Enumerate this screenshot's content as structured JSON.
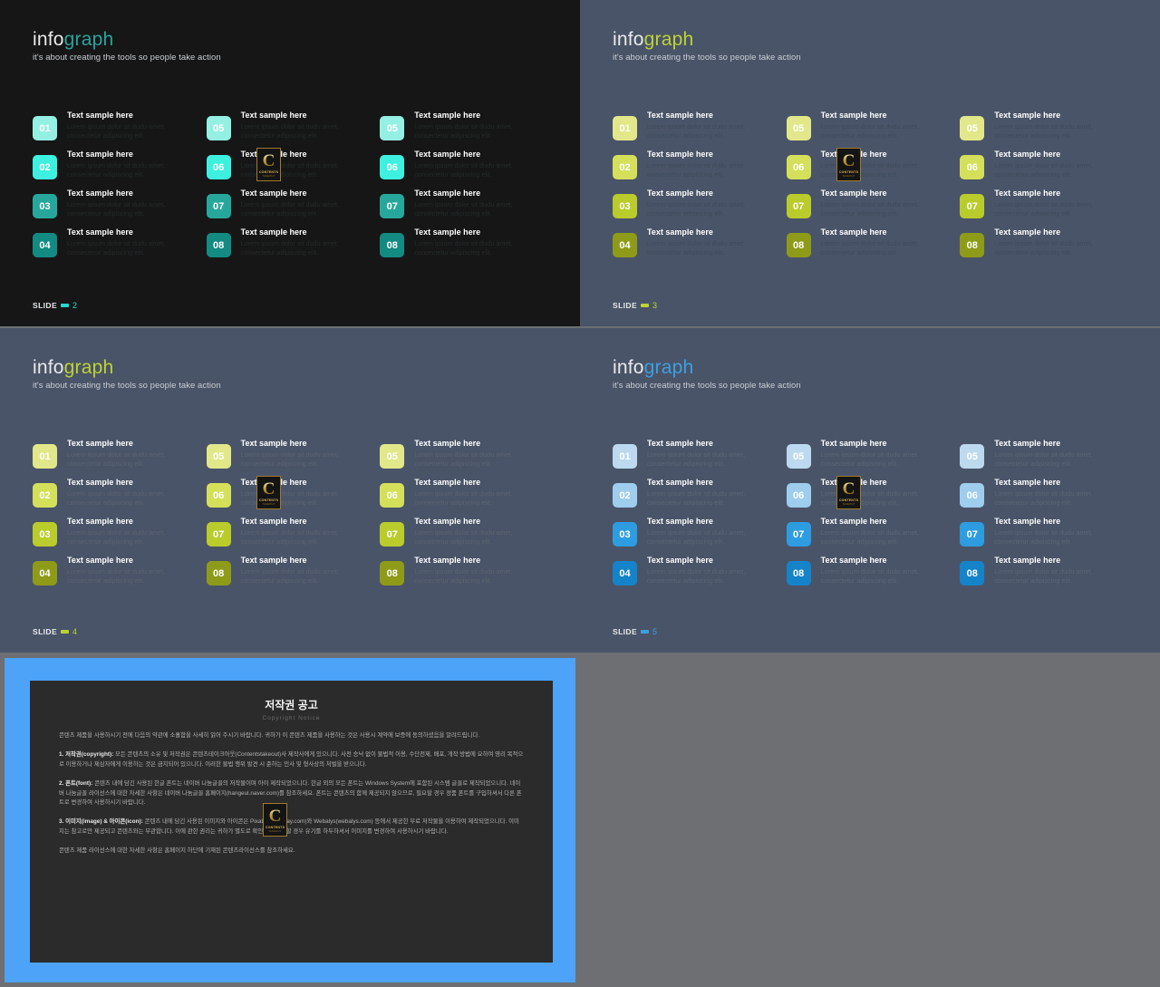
{
  "canvas": {
    "background": "#6d6f73"
  },
  "common": {
    "logo_part1": "info",
    "logo_part2": "graph",
    "tagline": "it's about creating the tools so people take action",
    "slide_label": "SLIDE",
    "item_title": "Text sample here",
    "item_desc": "Lorem ipsum dolor sit dudu amet, consectetur adipiscing elit.",
    "watermark": {
      "letter": "C",
      "line1": "CONTENTS",
      "line2": "TAKEOUT"
    }
  },
  "slides": [
    {
      "id": "slide-2",
      "number": "2",
      "background": "#161616",
      "accent": "#2bd6cf",
      "logo_accent": "#2aa39c",
      "desc_color": "#242a2a",
      "badge_colors": [
        "#95f0e4",
        "#3ef0e0",
        "#27a79c",
        "#138a82"
      ],
      "columns": [
        {
          "items": [
            {
              "num": "01",
              "title": "Text sample here",
              "desc": "Lorem ipsum dolor sit dudu amet, consectetur adipiscing elit."
            },
            {
              "num": "02",
              "title": "Text sample here",
              "desc": "Lorem ipsum dolor sit dudu amet, consectetur adipiscing elit."
            },
            {
              "num": "03",
              "title": "Text sample here",
              "desc": "Lorem ipsum dolor sit dudu amet, consectetur adipiscing elit."
            },
            {
              "num": "04",
              "title": "Text sample here",
              "desc": "Lorem ipsum dolor sit dudu amet, consectetur adipiscing elit."
            }
          ]
        },
        {
          "items": [
            {
              "num": "05",
              "title": "Text sample here",
              "desc": "Lorem ipsum dolor sit dudu amet, consectetur adipiscing elit."
            },
            {
              "num": "06",
              "title": "Text sample here",
              "desc": "Lorem ipsum dolor sit dudu amet, consectetur adipiscing elit."
            },
            {
              "num": "07",
              "title": "Text sample here",
              "desc": "Lorem ipsum dolor sit dudu amet, consectetur adipiscing elit."
            },
            {
              "num": "08",
              "title": "Text sample here",
              "desc": "Lorem ipsum dolor sit dudu amet, consectetur adipiscing elit."
            }
          ]
        },
        {
          "items": [
            {
              "num": "05",
              "title": "Text sample here",
              "desc": "Lorem ipsum dolor sit dudu amet, consectetur adipiscing elit."
            },
            {
              "num": "06",
              "title": "Text sample here",
              "desc": "Lorem ipsum dolor sit dudu amet, consectetur adipiscing elit."
            },
            {
              "num": "07",
              "title": "Text sample here",
              "desc": "Lorem ipsum dolor sit dudu amet, consectetur adipiscing elit."
            },
            {
              "num": "08",
              "title": "Text sample here",
              "desc": "Lorem ipsum dolor sit dudu amet, consectetur adipiscing elit."
            }
          ]
        }
      ]
    },
    {
      "id": "slide-3",
      "number": "3",
      "background": "#4a5468",
      "accent": "#bcd335",
      "logo_accent": "#bcd335",
      "desc_color": "#3d4b5c",
      "badge_colors": [
        "#e2e889",
        "#d4e05a",
        "#b9cc2c",
        "#8e9b18"
      ],
      "columns": [
        {
          "items": [
            {
              "num": "01",
              "title": "Text sample here",
              "desc": "Lorem ipsum dolor sit dudu amet, consectetur adipiscing elit."
            },
            {
              "num": "02",
              "title": "Text sample here",
              "desc": "Lorem ipsum dolor sit dudu amet, consectetur adipiscing elit."
            },
            {
              "num": "03",
              "title": "Text sample here",
              "desc": "Lorem ipsum dolor sit dudu amet, consectetur adipiscing elit."
            },
            {
              "num": "04",
              "title": "Text sample here",
              "desc": "Lorem ipsum dolor sit dudu amet, consectetur adipiscing elit."
            }
          ]
        },
        {
          "items": [
            {
              "num": "05",
              "title": "Text sample here",
              "desc": "Lorem ipsum dolor sit dudu amet, consectetur adipiscing elit."
            },
            {
              "num": "06",
              "title": "Text sample here",
              "desc": "Lorem ipsum dolor sit dudu amet, consectetur adipiscing elit."
            },
            {
              "num": "07",
              "title": "Text sample here",
              "desc": "Lorem ipsum dolor sit dudu amet, consectetur adipiscing elit."
            },
            {
              "num": "08",
              "title": "Text sample here",
              "desc": "Lorem ipsum dolor sit dudu amet, consectetur adipiscing elit."
            }
          ]
        },
        {
          "items": [
            {
              "num": "05",
              "title": "Text sample here",
              "desc": "Lorem ipsum dolor sit dudu amet, consectetur adipiscing elit."
            },
            {
              "num": "06",
              "title": "Text sample here",
              "desc": "Lorem ipsum dolor sit dudu amet, consectetur adipiscing elit."
            },
            {
              "num": "07",
              "title": "Text sample here",
              "desc": "Lorem ipsum dolor sit dudu amet, consectetur adipiscing elit."
            },
            {
              "num": "08",
              "title": "Text sample here",
              "desc": "Lorem ipsum dolor sit dudu amet, consectetur adipiscing elit."
            }
          ]
        }
      ]
    },
    {
      "id": "slide-4",
      "number": "4",
      "background": "#4a5468",
      "accent": "#bcd335",
      "logo_accent": "#bcd335",
      "desc_color": "#59636f",
      "badge_colors": [
        "#e2e889",
        "#d4e05a",
        "#b9cc2c",
        "#8e9b18"
      ],
      "columns": [
        {
          "items": [
            {
              "num": "01",
              "title": "Text sample here",
              "desc": "Lorem ipsum dolor sit dudu amet, consectetur adipiscing elit."
            },
            {
              "num": "02",
              "title": "Text sample here",
              "desc": "Lorem ipsum dolor sit dudu amet, consectetur adipiscing elit."
            },
            {
              "num": "03",
              "title": "Text sample here",
              "desc": "Lorem ipsum dolor sit dudu amet, consectetur adipiscing elit."
            },
            {
              "num": "04",
              "title": "Text sample here",
              "desc": "Lorem ipsum dolor sit dudu amet, consectetur adipiscing elit."
            }
          ]
        },
        {
          "items": [
            {
              "num": "05",
              "title": "Text sample here",
              "desc": "Lorem ipsum dolor sit dudu amet, consectetur adipiscing elit."
            },
            {
              "num": "06",
              "title": "Text sample here",
              "desc": "Lorem ipsum dolor sit dudu amet, consectetur adipiscing elit."
            },
            {
              "num": "07",
              "title": "Text sample here",
              "desc": "Lorem ipsum dolor sit dudu amet, consectetur adipiscing elit."
            },
            {
              "num": "08",
              "title": "Text sample here",
              "desc": "Lorem ipsum dolor sit dudu amet, consectetur adipiscing elit."
            }
          ]
        },
        {
          "items": [
            {
              "num": "05",
              "title": "Text sample here",
              "desc": "Lorem ipsum dolor sit dudu amet, consectetur adipiscing elit."
            },
            {
              "num": "06",
              "title": "Text sample here",
              "desc": "Lorem ipsum dolor sit dudu amet, consectetur adipiscing elit."
            },
            {
              "num": "07",
              "title": "Text sample here",
              "desc": "Lorem ipsum dolor sit dudu amet, consectetur adipiscing elit."
            },
            {
              "num": "08",
              "title": "Text sample here",
              "desc": "Lorem ipsum dolor sit dudu amet, consectetur adipiscing elit."
            }
          ]
        }
      ]
    },
    {
      "id": "slide-5",
      "number": "5",
      "background": "#4a5468",
      "accent": "#3d9fe0",
      "logo_accent": "#3d9fe0",
      "desc_color": "#5a6575",
      "badge_colors": [
        "#bcd9ef",
        "#9ecdee",
        "#2e9ce0",
        "#1583c9"
      ],
      "columns": [
        {
          "items": [
            {
              "num": "01",
              "title": "Text sample here",
              "desc": "Lorem ipsum dolor sit dudu amet, consectetur adipiscing elit."
            },
            {
              "num": "02",
              "title": "Text sample here",
              "desc": "Lorem ipsum dolor sit dudu amet, consectetur adipiscing elit."
            },
            {
              "num": "03",
              "title": "Text sample here",
              "desc": "Lorem ipsum dolor sit dudu amet, consectetur adipiscing elit."
            },
            {
              "num": "04",
              "title": "Text sample here",
              "desc": "Lorem ipsum dolor sit dudu amet, consectetur adipiscing elit."
            }
          ]
        },
        {
          "items": [
            {
              "num": "05",
              "title": "Text sample here",
              "desc": "Lorem ipsum dolor sit dudu amet, consectetur adipiscing elit."
            },
            {
              "num": "06",
              "title": "Text sample here",
              "desc": "Lorem ipsum dolor sit dudu amet, consectetur adipiscing elit."
            },
            {
              "num": "07",
              "title": "Text sample here",
              "desc": "Lorem ipsum dolor sit dudu amet, consectetur adipiscing elit."
            },
            {
              "num": "08",
              "title": "Text sample here",
              "desc": "Lorem ipsum dolor sit dudu amet, consectetur adipiscing elit."
            }
          ]
        },
        {
          "items": [
            {
              "num": "05",
              "title": "Text sample here",
              "desc": "Lorem ipsum dolor sit dudu amet, consectetur adipiscing elit."
            },
            {
              "num": "06",
              "title": "Text sample here",
              "desc": "Lorem ipsum dolor sit dudu amet, consectetur adipiscing elit."
            },
            {
              "num": "07",
              "title": "Text sample here",
              "desc": "Lorem ipsum dolor sit dudu amet, consectetur adipiscing elit."
            },
            {
              "num": "08",
              "title": "Text sample here",
              "desc": "Lorem ipsum dolor sit dudu amet, consectetur adipiscing elit."
            }
          ]
        }
      ]
    }
  ],
  "copyright_slide": {
    "id": "slide-6",
    "frame_color": "#4da3f7",
    "doc_background": "#2b2b2b",
    "title": "저작권 공고",
    "subtitle": "Copyright Notice",
    "paragraphs": [
      "콘텐츠 제품을 사용하시기 전에 다음의 약관에 소홀함을 사세히 읽어 주시기 바랍니다. 귀하가 이 콘텐츠 제품을 사용하는 것은 사용시 계약에 보증에 동의하셨음을 알려드립니다.",
      "1. 저작권(copyright): 모든 콘텐츠의 소유 및 저작권은 콘텐츠테이크아웃(Contentstakeout)사 제작사에게 있으니다. 사전 승낙 없이 물법적 이용, 수단전제, 배포, 개작 방법에 요하여 영리 목적으로 이용하거나 제삼자에게 이용하는 것은 금지되어 있으니다. 이러한 물법 행위 발견 시 준하는 민사 및 형사상의 처벌을 받으니다.",
      "2. 폰트(font): 콘텐츠 내에 담긴 사용된 한글 폰트는 네이버 나눔글꼴의 저작물이며 아이 제작되었으니다. 한글 외의 모든 폰트는 Windows System에 포함된 시스템 글꼴로 제작되었으니다. 네이버 나눔글꼴 라이선스에 대한 자세한 사항은 네이버 나눔글꼴 홈페이지(hangeul.naver.com)를 참조하세요. 폰트는 콘텐츠의 함께 제공되지 않으므로, 필요할 경우 정품 폰트를 구입하셔서 다른 폰트로 변경하여 사용하시기 바랍니다.",
      "3. 이미지(image) & 아이콘(icon): 콘텐츠 내에 담긴 사용된 이미지와 아이콘은 Pixabay(pixabay.com)와 Webalys(webalys.com) 등에서 제공한 무료 저작물을 이용하여 제작되었으니다. 이미지는 참고로만 제공되고 콘텐츠와는 무관합니다. 이에 관한 권리는 귀하가 별도로 확인하고 필요할 경우 유기를 하두하셔서 이미지를 변경하여 사용하시기 바랍니다.",
      "콘텐츠 제품 라이선스에 대한 자세한 사항은 홈페이지 하단에 기재된 콘텐츠라이선스를 참조하세요."
    ]
  }
}
